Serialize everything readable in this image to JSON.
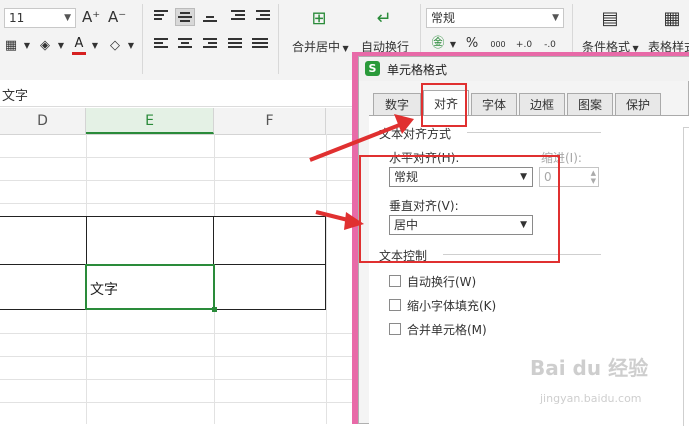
{
  "ribbon": {
    "font_size_value": "11",
    "font_grow": "A⁺",
    "font_shrink": "A⁻",
    "font_color": "A",
    "merge_center_label": "合并居中",
    "wrap_text_label": "自动换行",
    "number_format_value": "常规",
    "percent": "%",
    "thousands": "000",
    "decimal_inc": "+.0",
    "decimal_dec": "-.0",
    "conditional_format_label": "条件格式",
    "table_style_label": "表格样式"
  },
  "formula_bar": {
    "cell_content": "文字"
  },
  "sheet": {
    "columns": [
      "D",
      "E",
      "F"
    ],
    "selected_column": "E",
    "cell_text": "文字"
  },
  "dialog": {
    "title": "单元格格式",
    "tabs": [
      "数字",
      "对齐",
      "字体",
      "边框",
      "图案",
      "保护"
    ],
    "active_tab": "对齐",
    "text_alignment_group": "文本对齐方式",
    "horizontal_label": "水平对齐(H):",
    "horizontal_value": "常规",
    "indent_label": "缩进(I):",
    "indent_value": "0",
    "vertical_label": "垂直对齐(V):",
    "vertical_value": "居中",
    "text_control_group": "文本控制",
    "wrap_text": "自动换行(W)",
    "shrink_to_fit": "缩小字体填充(K)",
    "merge_cells": "合并单元格(M)"
  },
  "watermark": {
    "brand": "Bai du 经验",
    "url": "jingyan.baidu.com"
  },
  "colors": {
    "accent_green": "#2a8b3a",
    "annotation_red": "#e03030",
    "dialog_frame": "#e86aa8"
  }
}
